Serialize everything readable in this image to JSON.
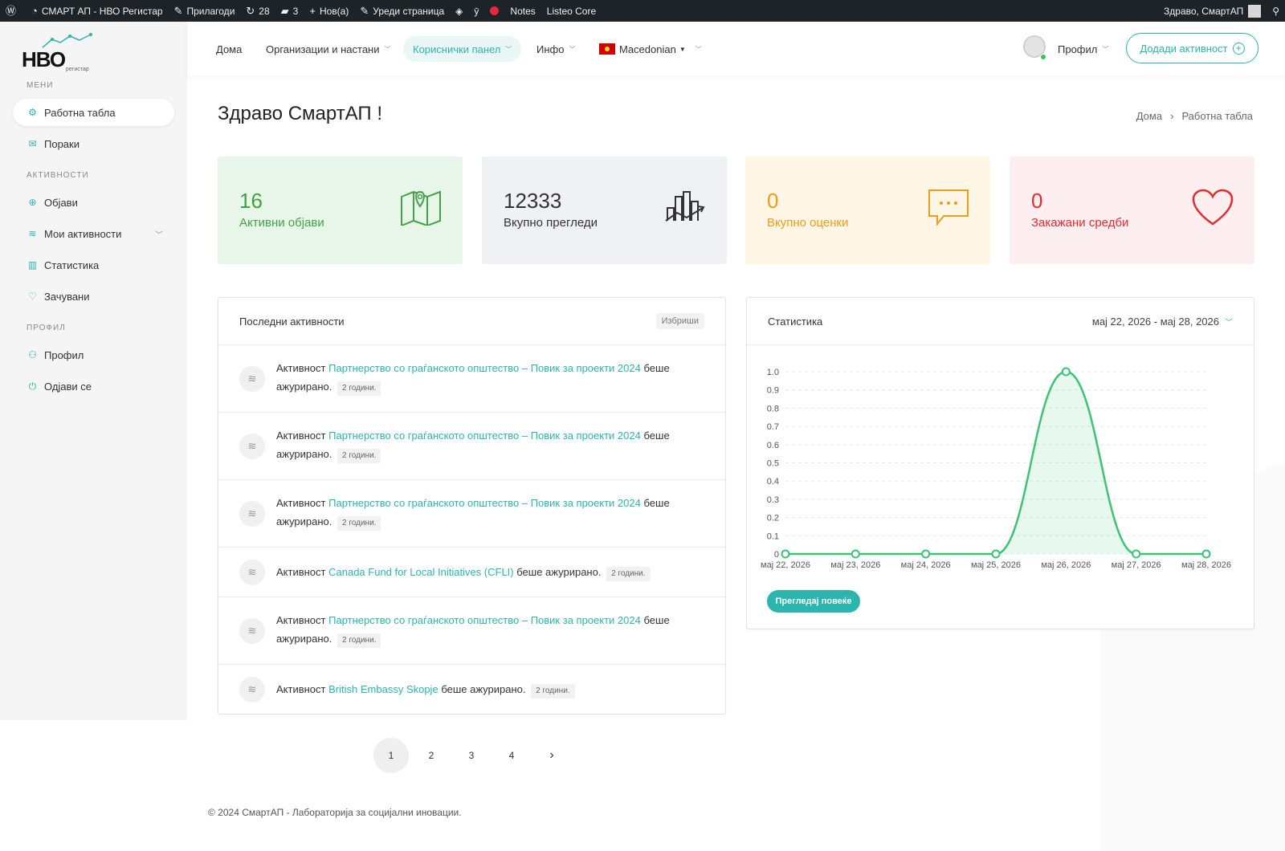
{
  "adminbar": {
    "site_name": "СМАРТ АП - НВО Регистар",
    "customize": "Прилагоди",
    "updates": "28",
    "comments": "3",
    "new": "Нов(а)",
    "edit_page": "Уреди страница",
    "notes": "Notes",
    "listeo": "Listeo Core",
    "greeting": "Здраво, СмартАП"
  },
  "logo": {
    "text": "НВО",
    "sub": "регистар"
  },
  "sidebar": {
    "menu_head": "МЕНИ",
    "activities_head": "АКТИВНОСТИ",
    "profile_head": "ПРОФИЛ",
    "items": {
      "dashboard": "Работна табла",
      "messages": "Пораки",
      "post": "Објави",
      "my_activities": "Мои активности",
      "statistics": "Статистика",
      "saved": "Зачувани",
      "profile": "Профил",
      "logout": "Одјави се"
    }
  },
  "topnav": {
    "home": "Дома",
    "orgs": "Организации и настани",
    "panel": "Кориснички панел",
    "info": "Инфо",
    "language": "Macedonian",
    "profile": "Профил",
    "add_activity": "Додади активност"
  },
  "page": {
    "title": "Здраво СмартАП !",
    "breadcrumb_home": "Дома",
    "breadcrumb_current": "Работна табла"
  },
  "stats": [
    {
      "value": "16",
      "label": "Активни објави",
      "color": "#43a047",
      "bg": "#e7f6e9",
      "icon": "map-icon"
    },
    {
      "value": "12333",
      "label": "Вкупно прегледи",
      "color": "#333333",
      "bg": "#f0f1f5",
      "icon": "chart-icon"
    },
    {
      "value": "0",
      "label": "Вкупно оценки",
      "color": "#ef9b1b",
      "bg": "#fff6e5",
      "icon": "message-icon"
    },
    {
      "value": "0",
      "label": "Закажани средби",
      "color": "#e52b32",
      "bg": "#fdeeef",
      "icon": "heart-icon"
    }
  ],
  "activities": {
    "title": "Последни активности",
    "clear": "Избриши",
    "rows": [
      {
        "prefix": "Активност",
        "link": "Партнерство со граѓанското општество – Повик за проекти 2024",
        "suffix": "беше ажурирано.",
        "time": "2 години."
      },
      {
        "prefix": "Активност",
        "link": "Партнерство со граѓанското општество – Повик за проекти 2024",
        "suffix": "беше ажурирано.",
        "time": "2 години."
      },
      {
        "prefix": "Активност",
        "link": "Партнерство со граѓанското општество – Повик за проекти 2024",
        "suffix": "беше ажурирано.",
        "time": "2 години."
      },
      {
        "prefix": "Активност",
        "link": "Canada Fund for Local Initiatives (CFLI)",
        "suffix": "беше ажурирано.",
        "time": "2 години."
      },
      {
        "prefix": "Активност",
        "link": "Партнерство со граѓанското општество – Повик за проекти 2024",
        "suffix": "беше ажурирано.",
        "time": "2 години."
      },
      {
        "prefix": "Активност",
        "link": "British Embassy Skopje",
        "suffix": "беше ажурирано.",
        "time": "2 години."
      }
    ]
  },
  "statistics": {
    "title": "Статистика",
    "date_range": "мај 22, 2026 - мај 28, 2026",
    "more_button": "Прегледај повеќе"
  },
  "chart_data": {
    "type": "line",
    "categories": [
      "мај 22, 2026",
      "мај 23, 2026",
      "мај 24, 2026",
      "мај 25, 2026",
      "мај 26, 2026",
      "мај 27, 2026",
      "мај 28, 2026"
    ],
    "values": [
      0,
      0,
      0,
      0,
      1,
      0,
      0
    ],
    "ylim": [
      0,
      1.0
    ],
    "yticks": [
      "0",
      "0.1",
      "0.2",
      "0.3",
      "0.4",
      "0.5",
      "0.6",
      "0.7",
      "0.8",
      "0.9",
      "1.0"
    ],
    "grid": true,
    "color": "#3cc373",
    "area": true
  },
  "pagination": {
    "pages": [
      "1",
      "2",
      "3",
      "4"
    ],
    "next": "›"
  },
  "footer": "© 2024 СмартАП - Лабораторија за социјални иновации."
}
